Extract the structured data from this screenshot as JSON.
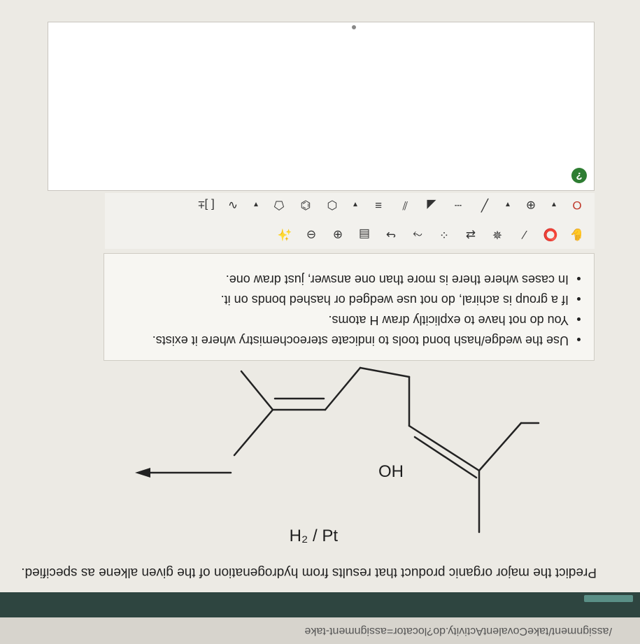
{
  "browser": {
    "url": "/assignment/takeCovalentActivity.do?locator=assignment-take"
  },
  "question": {
    "prompt": "Predict the major organic product that results from hydrogenation of the given alkene as specified.",
    "oh_label": "OH",
    "reagent": "H₂ / Pt"
  },
  "instructions": [
    "Use the wedge/hash bond tools to indicate stereochemistry where it exists.",
    "You do not have to explicitly draw H atoms.",
    "If a group is achiral, do not use wedged or hashed bonds on it.",
    "In cases where there is more than one answer, just draw one."
  ],
  "toolbar": {
    "row1": [
      {
        "name": "hand-icon",
        "glyph": "✋"
      },
      {
        "name": "lasso-icon",
        "glyph": "⭕"
      },
      {
        "name": "eraser-icon",
        "glyph": "∕"
      },
      {
        "name": "ring-template-icon",
        "glyph": "✵"
      },
      {
        "name": "arrow-template-icon",
        "glyph": "⇄"
      },
      {
        "name": "atom-map-icon",
        "glyph": "⁘"
      },
      {
        "name": "curved-arrow-icon",
        "glyph": "⤳"
      },
      {
        "name": "reaction-arrow-icon",
        "glyph": "↪"
      },
      {
        "name": "text-tool-icon",
        "glyph": "▤"
      },
      {
        "name": "zoom-in-icon",
        "glyph": "⊕"
      },
      {
        "name": "zoom-out-icon",
        "glyph": "⊖"
      },
      {
        "name": "clean-icon",
        "glyph": "✨"
      }
    ],
    "row2": [
      {
        "name": "atom-oxygen-button",
        "glyph": "O",
        "color": "red"
      },
      {
        "name": "atom-dropdown-icon",
        "glyph": "▾"
      },
      {
        "name": "charge-plus-icon",
        "glyph": "⊕"
      },
      {
        "name": "charge-dropdown-icon",
        "glyph": "▾"
      },
      {
        "name": "single-bond-icon",
        "glyph": "╱"
      },
      {
        "name": "hashed-bond-icon",
        "glyph": "┄"
      },
      {
        "name": "wedge-bond-icon",
        "glyph": "◢"
      },
      {
        "name": "double-bond-icon",
        "glyph": "⫽"
      },
      {
        "name": "triple-bond-icon",
        "glyph": "≡"
      },
      {
        "name": "bond-dropdown-icon",
        "glyph": "▾"
      },
      {
        "name": "cyclohexane-icon",
        "glyph": "⬡"
      },
      {
        "name": "benzene-icon",
        "glyph": "⌬"
      },
      {
        "name": "cyclopentane-icon",
        "glyph": "⬠"
      },
      {
        "name": "ring-dropdown-icon",
        "glyph": "▾"
      },
      {
        "name": "chain-tool-icon",
        "glyph": "∿"
      },
      {
        "name": "bracket-tool-icon",
        "glyph": "[ ]±"
      }
    ]
  },
  "help": {
    "label": "?"
  }
}
